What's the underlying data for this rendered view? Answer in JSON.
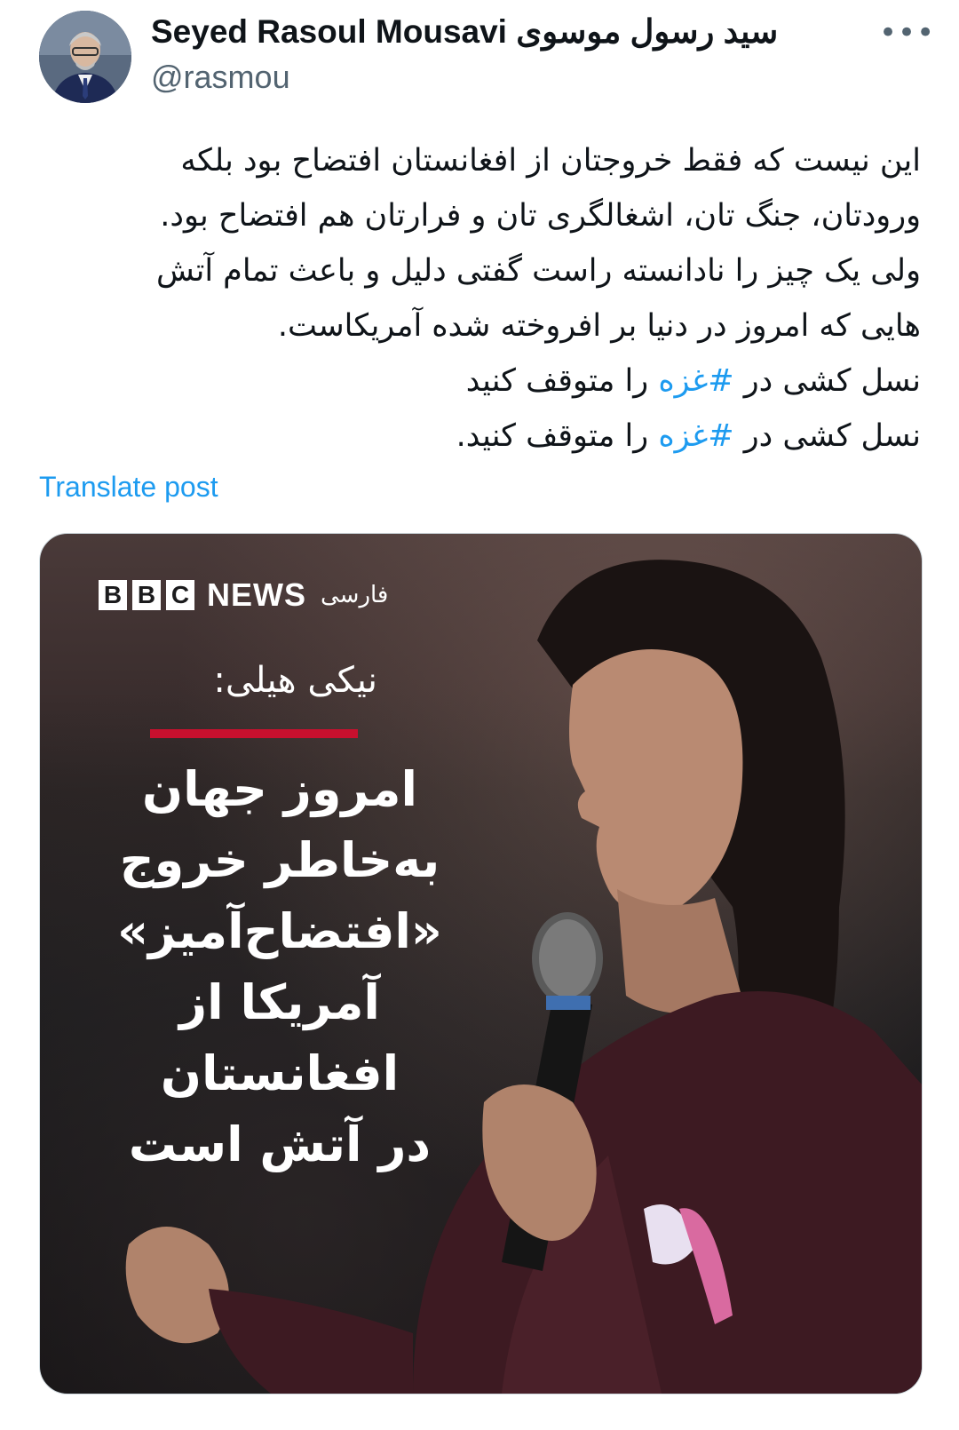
{
  "author": {
    "display_name": "Seyed Rasoul Mousavi سید رسول موسوی",
    "handle": "@rasmou",
    "avatar_icon": "avatar-photo"
  },
  "more_label": "•••",
  "body": {
    "line1": "این نیست که فقط خروجتان از افغانستان افتضاح بود بلکه",
    "line2": "ورودتان، جنگ تان، اشغالگری تان  و فرارتان هم افتضاح بود.",
    "line3": "ولی یک چیز را نادانسته راست گفتی دلیل و باعث تمام آتش",
    "line4": "هایی که امروز در دنیا بر افروخته شده آمریکاست.",
    "line5_pre": "نسل کشی در ",
    "line5_tag": "#غزه",
    "line5_post": " را متوقف کنید",
    "line6_pre": "نسل کشی در ",
    "line6_tag": "#غزه",
    "line6_post": " را متوقف کنید."
  },
  "translate_label": "Translate post",
  "media": {
    "logo_letters": [
      "B",
      "B",
      "C"
    ],
    "logo_news": "NEWS",
    "logo_farsi": "فارسی",
    "speaker": "نیکی هیلی:",
    "headline_lines": [
      "امروز جهان",
      "به‌خاطر خروج",
      "«افتضاح‌آمیز»",
      "آمریکا از افغانستان",
      "در آتش است"
    ]
  },
  "colors": {
    "hashtag": "#1d9bf0",
    "handle": "#536471",
    "accent_red": "#c8102e"
  }
}
